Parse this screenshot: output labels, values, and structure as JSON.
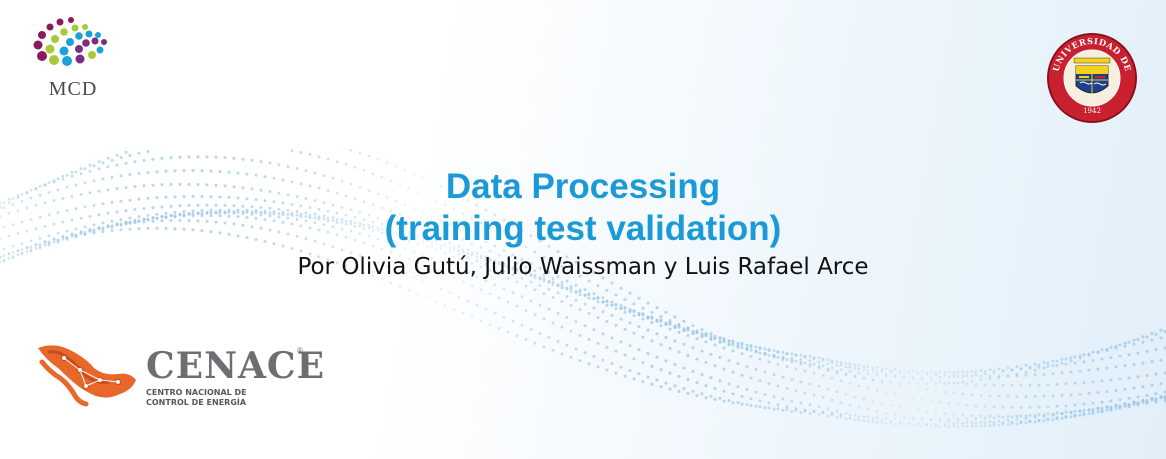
{
  "slide": {
    "title_line1": "Data Processing",
    "title_line2": "(training test validation)",
    "authors": "Por Olivia Gutú, Julio Waissman y Luis Rafael Arce"
  },
  "logos": {
    "mcd": {
      "label": "MCD",
      "icon": "mcd-dots-logo",
      "colors": [
        "#8a1c5c",
        "#a7c93a",
        "#1aa2d8",
        "#7b2d82"
      ]
    },
    "university": {
      "seal_text": "UNIVERSIDAD DE SONORA",
      "year": "1942",
      "icon": "university-seal",
      "colors": [
        "#c8202f",
        "#1c3f8f",
        "#f4d21a"
      ]
    },
    "cenace": {
      "name": "CENACE",
      "registered": "®",
      "subtitle_line1": "CENTRO NACIONAL DE",
      "subtitle_line2": "CONTROL DE ENERGÍA",
      "icon": "mexico-map-logo",
      "colors": [
        "#e8672a",
        "#c74b1e",
        "#6d6e71"
      ]
    }
  },
  "theme": {
    "title_color": "#1a9ad6",
    "wave_color": "#9cc6e6"
  }
}
